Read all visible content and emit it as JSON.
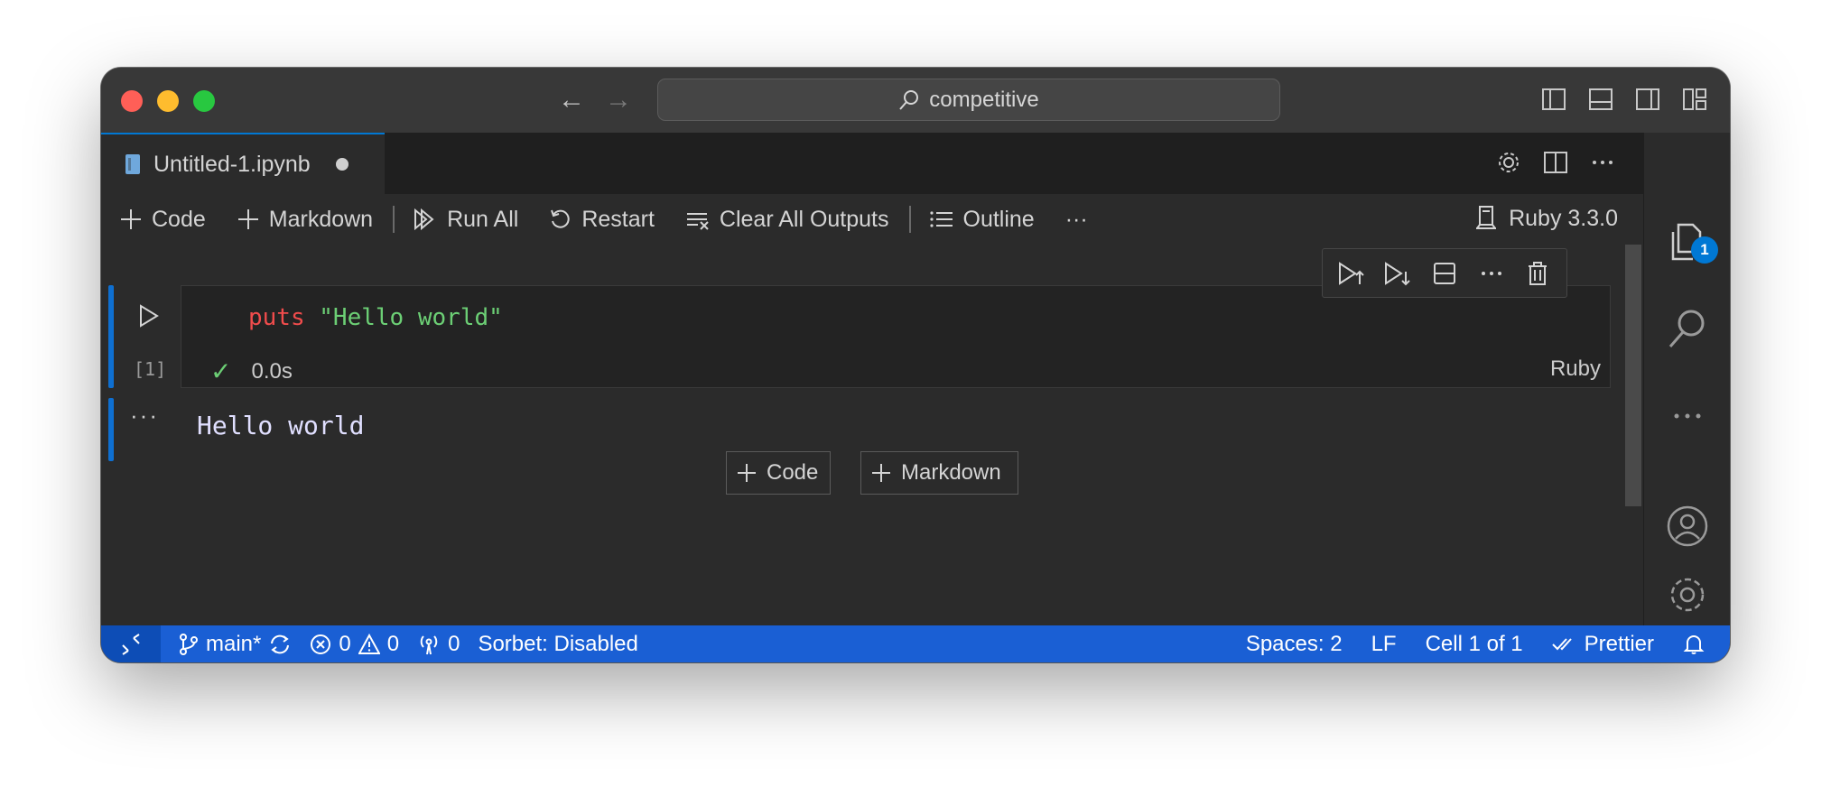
{
  "titlebar": {
    "search_text": "competitive",
    "back_icon": "arrow-left-icon",
    "forward_icon": "arrow-right-icon"
  },
  "tab": {
    "filename": "Untitled-1.ipynb"
  },
  "notebook_toolbar": {
    "add_code": "Code",
    "add_markdown": "Markdown",
    "run_all": "Run All",
    "restart": "Restart",
    "clear_outputs": "Clear All Outputs",
    "outline": "Outline",
    "more": "···",
    "kernel": "Ruby 3.3.0"
  },
  "cell": {
    "execution_count": "[1]",
    "code_keyword": "puts",
    "code_string": "\"Hello world\"",
    "duration": "0.0s",
    "language": "Ruby",
    "output_more": "···",
    "output": "Hello world"
  },
  "insert_buttons": {
    "code": "Code",
    "markdown": "Markdown"
  },
  "activity_bar": {
    "explorer_badge": "1"
  },
  "statusbar": {
    "branch": "main*",
    "errors": "0",
    "warnings": "0",
    "ports": "0",
    "sorbet": "Sorbet: Disabled",
    "spaces": "Spaces: 2",
    "eol": "LF",
    "cell_position": "Cell 1 of 1",
    "formatter": "Prettier"
  },
  "colors": {
    "accent": "#0078d4",
    "statusbar": "#1a5fd4",
    "keyword": "#f14c4c",
    "string": "#6ccf75"
  }
}
